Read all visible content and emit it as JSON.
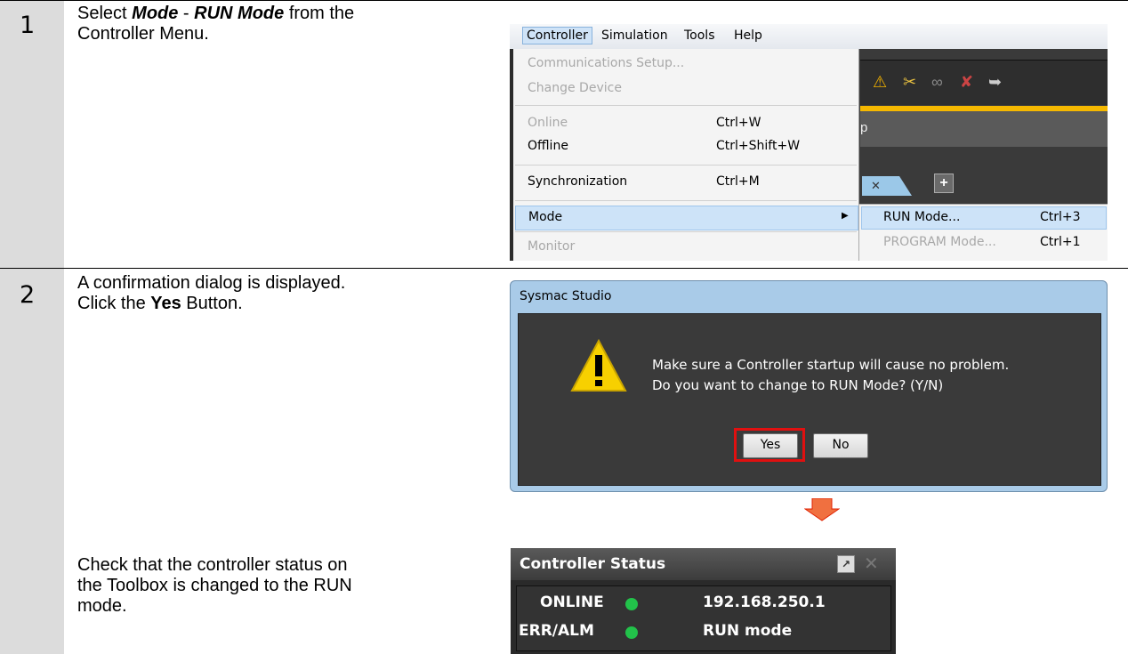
{
  "steps": [
    {
      "number": "1",
      "instruction_parts": {
        "a": "Select ",
        "mode": "Mode",
        "dash": " - ",
        "run": "RUN Mode",
        "b": " from the",
        "c": "Controller Menu."
      }
    },
    {
      "number": "2",
      "instruction_line1": "A confirmation dialog is displayed.",
      "instruction_line2_a": "Click the ",
      "instruction_line2_b": "Yes",
      "instruction_line2_c": " Button.",
      "check_lines": [
        "Check that the controller status on",
        "the Toolbox is changed to the RUN",
        "mode."
      ]
    }
  ],
  "menubar": [
    "Controller",
    "Simulation",
    "Tools",
    "Help"
  ],
  "controller_menu": [
    {
      "label": "Communications Setup...",
      "shortcut": "",
      "disabled": true
    },
    {
      "label": "Change Device",
      "shortcut": "",
      "disabled": true
    },
    {
      "label": "Online",
      "shortcut": "Ctrl+W",
      "disabled": true
    },
    {
      "label": "Offline",
      "shortcut": "Ctrl+Shift+W",
      "disabled": false
    },
    {
      "label": "Synchronization",
      "shortcut": "Ctrl+M",
      "disabled": false
    },
    {
      "label": "Mode",
      "shortcut": "",
      "disabled": false
    },
    {
      "label": "Monitor",
      "shortcut": "",
      "disabled": true
    }
  ],
  "mode_submenu": [
    {
      "label": "RUN Mode...",
      "shortcut": "Ctrl+3"
    },
    {
      "label": "PROGRAM Mode...",
      "shortcut": "Ctrl+1"
    }
  ],
  "background_letter": "p",
  "dialog": {
    "title": "Sysmac Studio",
    "line1": "Make sure a Controller startup will cause no problem.",
    "line2": "Do you want to change to RUN Mode? (Y/N)",
    "yes": "Yes",
    "no": "No"
  },
  "controller_status": {
    "title": "Controller Status",
    "rows": [
      {
        "label": "ONLINE",
        "value": "192.168.250.1"
      },
      {
        "label": "ERR/ALM",
        "value": "RUN mode"
      }
    ]
  }
}
